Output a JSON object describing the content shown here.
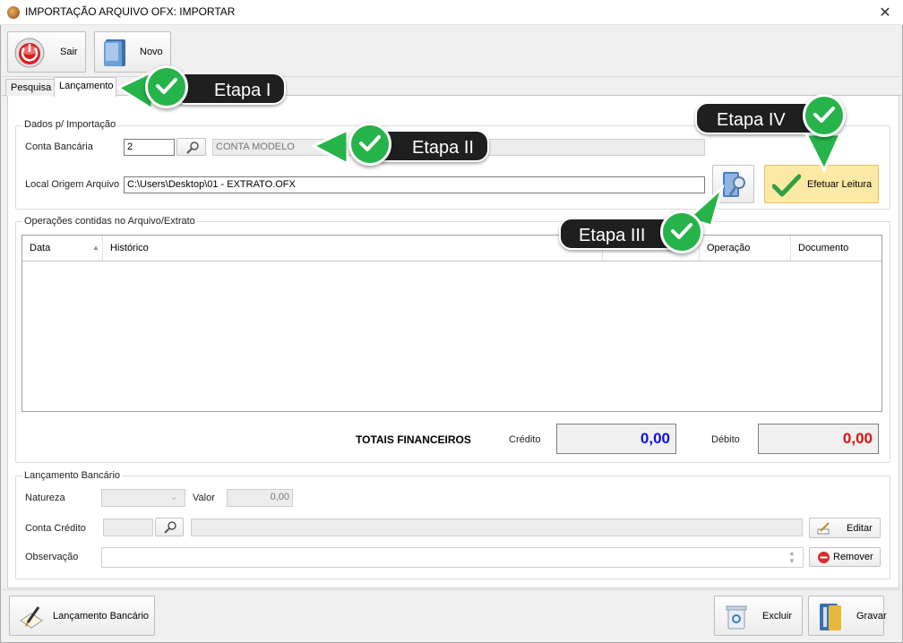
{
  "window": {
    "title": "IMPORTAÇÃO ARQUIVO OFX: IMPORTAR",
    "close_glyph": "✕"
  },
  "toolbar": {
    "sair_label": "Sair",
    "novo_label": "Novo"
  },
  "tabs": [
    {
      "label": "Pesquisa"
    },
    {
      "label": "Lançamento"
    }
  ],
  "import_group": {
    "title": "Dados p/ Importação",
    "conta_label": "Conta Bancária",
    "conta_value": "2",
    "conta_name": "CONTA MODELO",
    "local_label": "Local Origem Arquivo",
    "local_value": "C:\\Users\\Desktop\\01 - EXTRATO.OFX",
    "efetuar_label": "Efetuar Leitura"
  },
  "ops_group": {
    "title": "Operações contidas no Arquivo/Extrato",
    "columns": [
      "Data",
      "Histórico",
      "Operação",
      "Documento"
    ]
  },
  "totals": {
    "title": "TOTAIS FINANCEIROS",
    "credito_label": "Crédito",
    "credito_value": "0,00",
    "debito_label": "Débito",
    "debito_value": "0,00"
  },
  "lancamento_group": {
    "title": "Lançamento Bancário",
    "natureza_label": "Natureza",
    "valor_label": "Valor",
    "valor_value": "0,00",
    "conta_credito_label": "Conta Crédito",
    "observacao_label": "Observação",
    "editar_label": "Editar",
    "remover_label": "Remover"
  },
  "footer": {
    "lancamento_label": "Lançamento Bancário",
    "excluir_label": "Excluir",
    "gravar_label": "Gravar"
  },
  "callouts": [
    "Etapa I",
    "Etapa II",
    "Etapa III",
    "Etapa IV"
  ],
  "colors": {
    "credito": "#1010e0",
    "debito": "#e01010",
    "callout_green": "#26b34a",
    "efetuar_bg": "#fde9a6"
  }
}
